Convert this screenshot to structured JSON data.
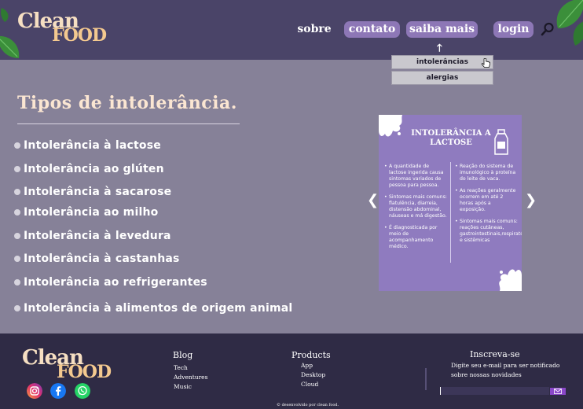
{
  "brand": {
    "line1": "Clean",
    "line2": "FOOD"
  },
  "nav": {
    "items": [
      {
        "label": "sobre"
      },
      {
        "label": "contato"
      },
      {
        "label": "saiba mais"
      },
      {
        "label": "login"
      }
    ],
    "dropdown_arrow": "🡑",
    "dropdown": [
      {
        "label": "intolerâncias"
      },
      {
        "label": "alergias"
      }
    ]
  },
  "main": {
    "title": "Tipos de intolerância.",
    "items": [
      "Intolerância à lactose",
      "Intolerância ao glúten",
      "Intolerância à sacarose",
      "Intolerância ao milho",
      "Intolerância à levedura",
      "Intolerância à castanhas",
      "Intolerância ao refrigerantes",
      "Intolerância à alimentos de origem animal"
    ]
  },
  "carousel": {
    "prev": "❮",
    "next": "❯",
    "slide": {
      "title": "INTOLERÂNCIA A LACTOSE",
      "left_points": [
        "A quantidade de lactose ingerida causa sintomas variados de pessoa para pessoa.",
        "Sintomas mais comuns: flatulência, diarreia, distensão abdominal, náuseas e má digestão.",
        "É diagnosticada por meio de acompanhamento médico."
      ],
      "right_points": [
        "Reação do sistema de imunológico à proteína do leite de vaca.",
        "As reações geralmente ocorrem em até 2 horas após a exposição.",
        "Sintomas mais comuns: reações cutâneas, gastrointestinais,respiratórias e sistêmicas"
      ]
    }
  },
  "footer": {
    "blog": {
      "title": "Blog",
      "links": [
        "Tech",
        "Adventures",
        "Music"
      ]
    },
    "products": {
      "title": "Products",
      "links": [
        "App",
        "Desktop",
        "Cloud"
      ]
    },
    "subscribe": {
      "title": "Inscreva-se",
      "description": "Digite seu e-mail para ser notificado sobre nossas novidades",
      "input_value": ""
    },
    "copyright": "© desenvolvido por clean food."
  },
  "colors": {
    "header_bg": "#4a4468",
    "body_bg": "#868198",
    "footer_bg": "#2f2b45",
    "nav_pill": "#8d77b6",
    "slide_bg": "#8f7bbf",
    "title_text": "#fbe6d2",
    "logo_cream": "#f6dfc2",
    "logo_orange": "#f4c98f",
    "leaf_green": "#3b8f3a",
    "subscribe_button": "#8a47c9"
  },
  "icons": {
    "search": "search-icon",
    "pointer": "pointer-hand-icon",
    "instagram": "instagram-icon",
    "facebook": "facebook-icon",
    "whatsapp": "whatsapp-icon",
    "mail": "mail-icon",
    "milk": "milk-bottle-icon",
    "leaf": "leaf-icon"
  }
}
